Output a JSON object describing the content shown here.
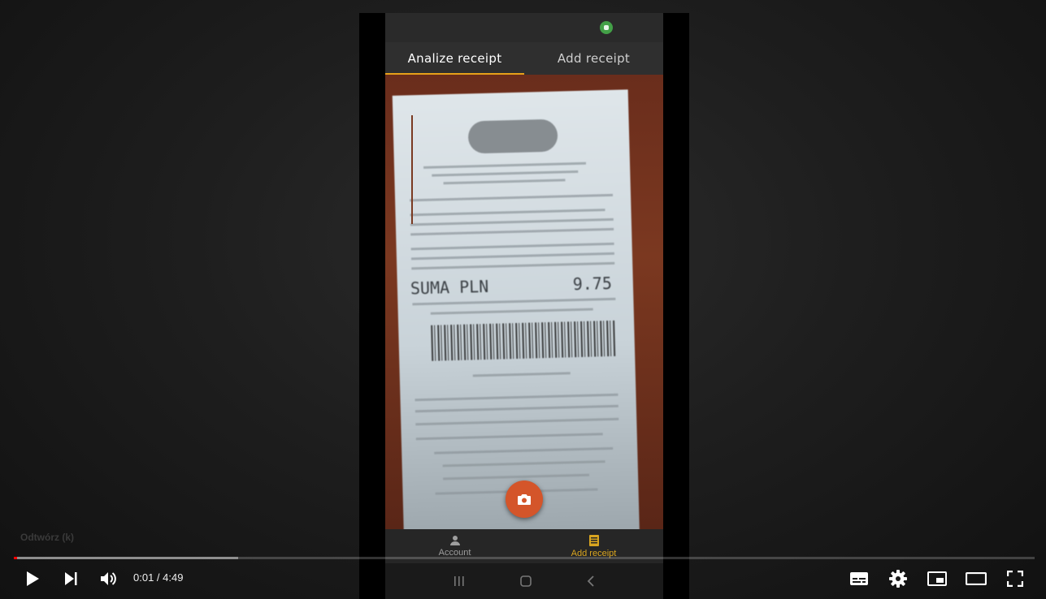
{
  "phone_app": {
    "tabs": [
      {
        "label": "Analize receipt",
        "active": true
      },
      {
        "label": "Add receipt",
        "active": false
      }
    ],
    "receipt": {
      "total_label": "SUMA PLN",
      "total_value": "9.75"
    },
    "bottom_nav": [
      {
        "label": "Account",
        "icon": "person-icon",
        "active": false
      },
      {
        "label": "Add receipt",
        "icon": "receipt-icon",
        "active": true
      }
    ],
    "colors": {
      "accent": "#e6a11a",
      "fab": "#d4552a",
      "nav_active": "#d9a520"
    }
  },
  "player": {
    "tooltip": "Odtwórz (k)",
    "current_time": "0:01",
    "separator": " / ",
    "duration": "4:49",
    "progress": {
      "played_fraction": 0.0035,
      "buffered_fraction": 0.22
    },
    "colors": {
      "played": "#ff0000"
    },
    "buttons": [
      "play-icon",
      "next-icon",
      "volume-icon",
      "subtitles-icon",
      "settings-gear-icon",
      "miniplayer-icon",
      "theater-mode-icon",
      "fullscreen-icon"
    ]
  }
}
